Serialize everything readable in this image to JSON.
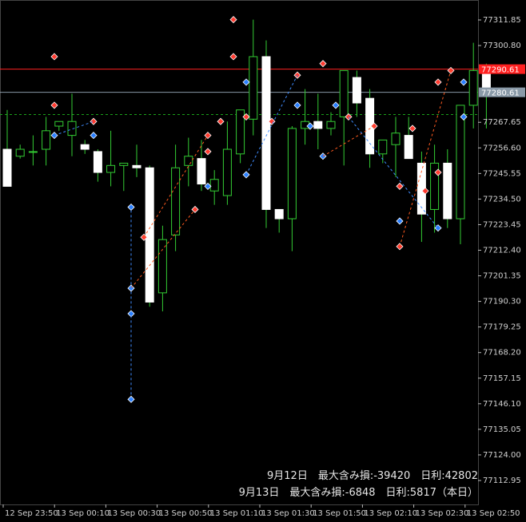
{
  "chart_data": {
    "type": "candlestick",
    "symbol_price_axis": [
      "77311.85",
      "77300.80",
      "77290.61",
      "77280.61",
      "77267.65",
      "77256.60",
      "77245.55",
      "77234.50",
      "77223.45",
      "77212.40",
      "77201.35",
      "77190.30",
      "77179.25",
      "77168.20",
      "77157.15",
      "77146.10",
      "77135.05",
      "77124.00",
      "77112.95"
    ],
    "y_ticks": [
      77311.85,
      77300.8,
      77267.65,
      77256.6,
      77245.55,
      77234.5,
      77223.45,
      77212.4,
      77201.35,
      77190.3,
      77179.25,
      77168.2,
      77157.15,
      77146.1,
      77135.05,
      77124.0,
      77112.95
    ],
    "ylim": [
      77104,
      77322
    ],
    "x_labels": [
      "12 Sep 23:50",
      "13 Sep 00:10",
      "13 Sep 00:30",
      "13 Sep 00:50",
      "13 Sep 01:10",
      "13 Sep 01:30",
      "13 Sep 01:50",
      "13 Sep 02:10",
      "13 Sep 02:30",
      "13 Sep 02:50"
    ],
    "hlines": [
      {
        "price": 77290.61,
        "label": "77290.61",
        "color": "#ff2020",
        "label_bg": "#ff2020"
      },
      {
        "price": 77280.61,
        "label": "77280.61",
        "color": "#8a9aa8",
        "label_bg": "#8a9aa8"
      },
      {
        "price": 77271.0,
        "label": "",
        "color": "#1aa01a",
        "dashed": true
      }
    ],
    "candles": [
      {
        "o": 77256,
        "h": 77273,
        "l": 77240,
        "c": 77240
      },
      {
        "o": 77253,
        "h": 77258,
        "l": 77252,
        "c": 77256
      },
      {
        "o": 77255,
        "h": 77262,
        "l": 77249,
        "c": 77255
      },
      {
        "o": 77256,
        "h": 77270,
        "l": 77249,
        "c": 77264
      },
      {
        "o": 77266,
        "h": 77266,
        "l": 77264,
        "c": 77268
      },
      {
        "o": 77262,
        "h": 77280,
        "l": 77253,
        "c": 77268
      },
      {
        "o": 77258,
        "h": 77260,
        "l": 77254,
        "c": 77256
      },
      {
        "o": 77255,
        "h": 77256,
        "l": 77242,
        "c": 77246
      },
      {
        "o": 77246,
        "h": 77264,
        "l": 77240,
        "c": 77249
      },
      {
        "o": 77249,
        "h": 77250,
        "l": 77238,
        "c": 77250
      },
      {
        "o": 77249,
        "h": 77258,
        "l": 77244,
        "c": 77248
      },
      {
        "o": 77248,
        "h": 77249,
        "l": 77188,
        "c": 77190
      },
      {
        "o": 77194,
        "h": 77223,
        "l": 77186,
        "c": 77217
      },
      {
        "o": 77219,
        "h": 77258,
        "l": 77212,
        "c": 77248
      },
      {
        "o": 77249,
        "h": 77261,
        "l": 77240,
        "c": 77253
      },
      {
        "o": 77252,
        "h": 77260,
        "l": 77238,
        "c": 77241
      },
      {
        "o": 77238,
        "h": 77247,
        "l": 77232,
        "c": 77243
      },
      {
        "o": 77236,
        "h": 77268,
        "l": 77232,
        "c": 77256
      },
      {
        "o": 77254,
        "h": 77273,
        "l": 77250,
        "c": 77273
      },
      {
        "o": 77269,
        "h": 77312,
        "l": 77262,
        "c": 77296
      },
      {
        "o": 77296,
        "h": 77303,
        "l": 77222,
        "c": 77230
      },
      {
        "o": 77230,
        "h": 77230,
        "l": 77220,
        "c": 77226
      },
      {
        "o": 77226,
        "h": 77266,
        "l": 77212,
        "c": 77265
      },
      {
        "o": 77265,
        "h": 77282,
        "l": 77258,
        "c": 77268
      },
      {
        "o": 77268,
        "h": 77280,
        "l": 77256,
        "c": 77265
      },
      {
        "o": 77265,
        "h": 77272,
        "l": 77262,
        "c": 77268
      },
      {
        "o": 77270,
        "h": 77290,
        "l": 77249,
        "c": 77290
      },
      {
        "o": 77287,
        "h": 77290,
        "l": 77270,
        "c": 77276
      },
      {
        "o": 77278,
        "h": 77282,
        "l": 77248,
        "c": 77254
      },
      {
        "o": 77254,
        "h": 77260,
        "l": 77250,
        "c": 77260
      },
      {
        "o": 77258,
        "h": 77270,
        "l": 77244,
        "c": 77263
      },
      {
        "o": 77262,
        "h": 77270,
        "l": 77255,
        "c": 77252
      },
      {
        "o": 77250,
        "h": 77255,
        "l": 77216,
        "c": 77228
      },
      {
        "o": 77230,
        "h": 77258,
        "l": 77220,
        "c": 77250
      },
      {
        "o": 77250,
        "h": 77256,
        "l": 77222,
        "c": 77226
      },
      {
        "o": 77226,
        "h": 77260,
        "l": 77215,
        "c": 77275
      },
      {
        "o": 77275,
        "h": 77302,
        "l": 77265,
        "c": 77290
      },
      {
        "o": 77290,
        "h": 77293,
        "l": 77265,
        "c": 77280
      }
    ]
  },
  "info": {
    "line1": "9月12日　最大含み損:-39420　日利:42802",
    "line2": "9月13日　最大含み損:-6848　日利:5817（本日）"
  },
  "colors": {
    "up": "#33cc33",
    "down_fill": "#ffffff",
    "buy": "#2a7fff",
    "sell": "#ff3b30",
    "dash_buy": "#3f8cff",
    "dash_sell": "#ff5a1f"
  }
}
